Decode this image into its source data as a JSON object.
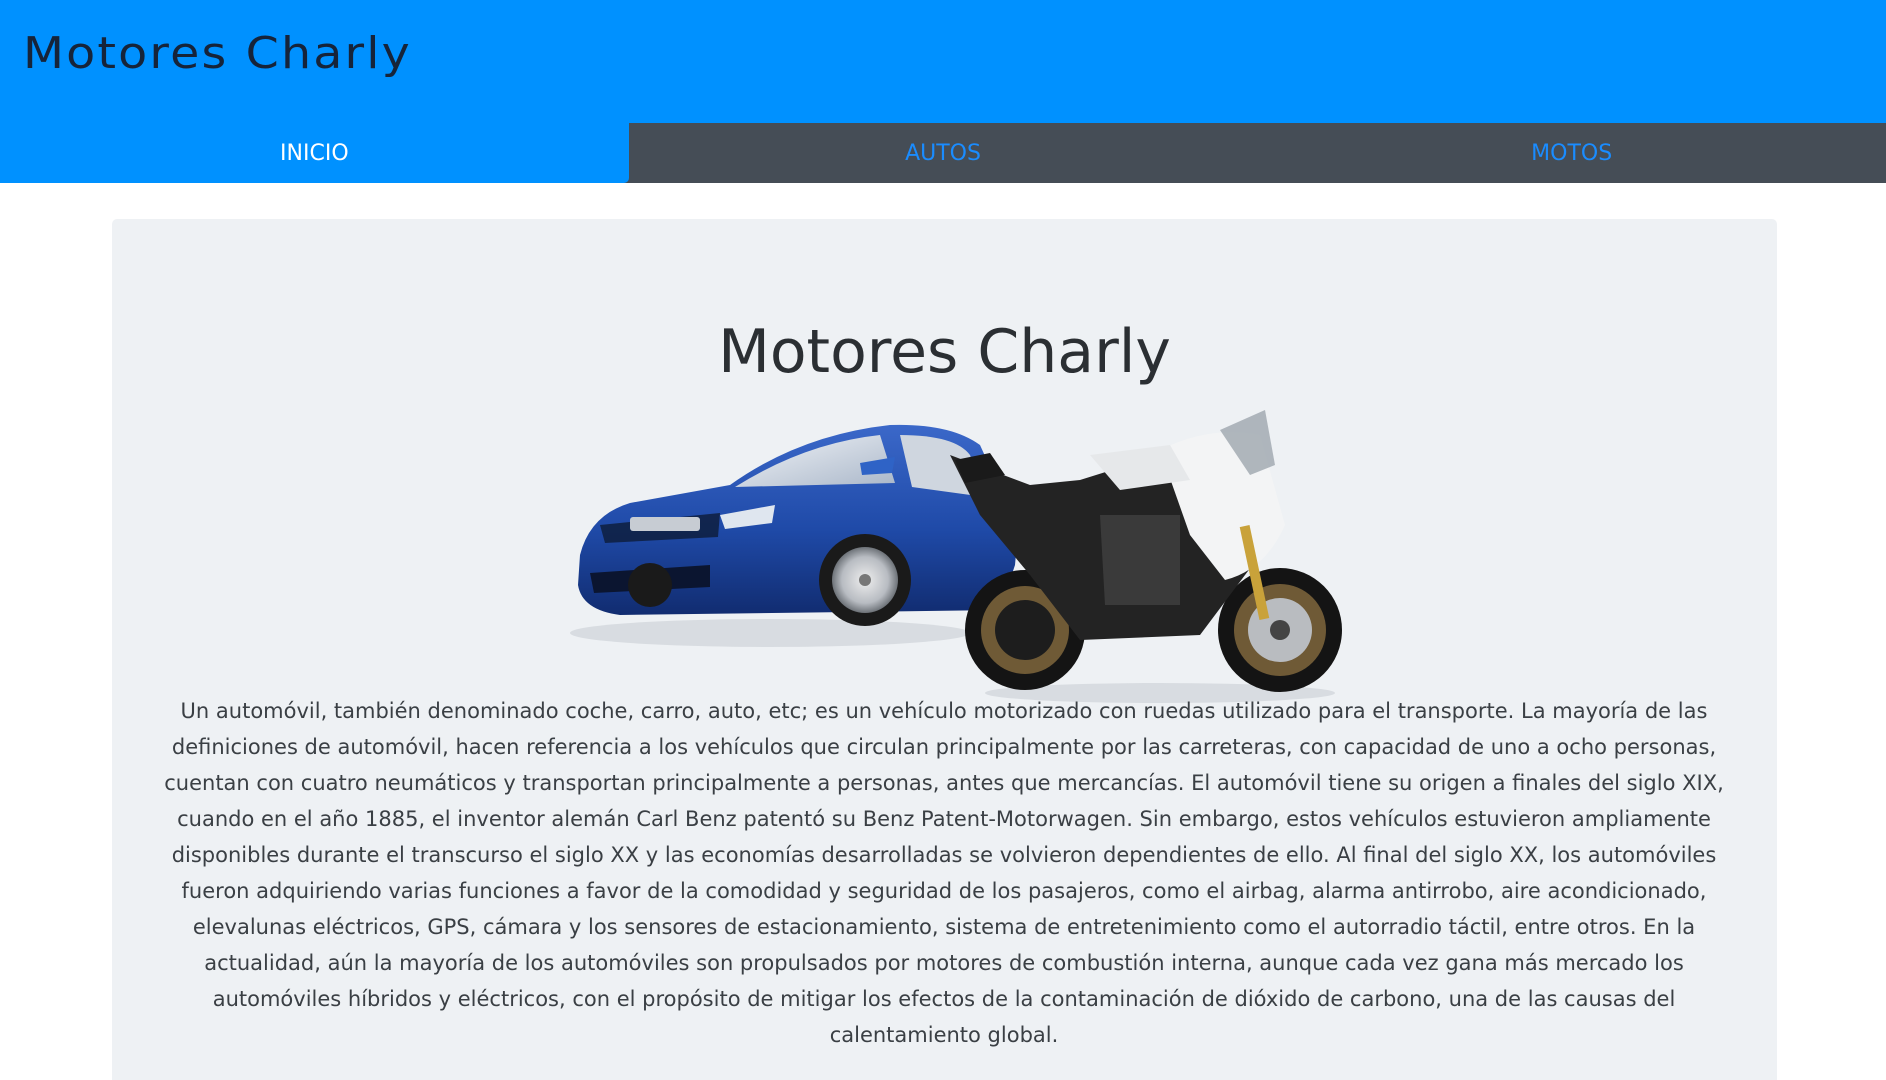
{
  "header": {
    "brand": "Motores Charly"
  },
  "nav": {
    "items": [
      {
        "label": "INICIO",
        "active": true
      },
      {
        "label": "AUTOS",
        "active": false
      },
      {
        "label": "MOTOS",
        "active": false
      }
    ]
  },
  "main": {
    "title": "Motores Charly",
    "description": "Un automóvil, también denominado coche, carro, auto, etc; es un vehículo motorizado con ruedas utilizado para el transporte. La mayoría de las definiciones de automóvil, hacen referencia a los vehículos que circulan principalmente por las carreteras, con capacidad de uno a ocho personas, cuentan con cuatro neumáticos y transportan principalmente a personas, antes que mercancías. El automóvil tiene su origen a finales del siglo XIX, cuando en el año 1885, el inventor alemán Carl Benz patentó su Benz Patent-Motorwagen. Sin embargo, estos vehículos estuvieron ampliamente disponibles durante el transcurso el siglo XX y las economías desarrolladas se volvieron dependientes de ello. Al final del siglo XX, los automóviles fueron adquiriendo varias funciones a favor de la comodidad y seguridad de los pasajeros, como el airbag, alarma antirrobo, aire acondicionado, elevalunas eléctricos, GPS, cámara y los sensores de estacionamiento, sistema de entretenimiento como el autorradio táctil, entre otros. En la actualidad, aún la mayoría de los automóviles son propulsados por motores de combustión interna, aunque cada vez gana más mercado los automóviles híbridos y eléctricos, con el propósito de mitigar los efectos de la contaminación de dióxido de carbono, una de las causas del calentamiento global."
  },
  "colors": {
    "header_bg": "#0091ff",
    "nav_bg": "#454d56",
    "nav_link": "#1a8cff",
    "jumbotron_bg": "#eef1f4"
  },
  "icons": [
    "car-image",
    "motorcycle-image"
  ]
}
